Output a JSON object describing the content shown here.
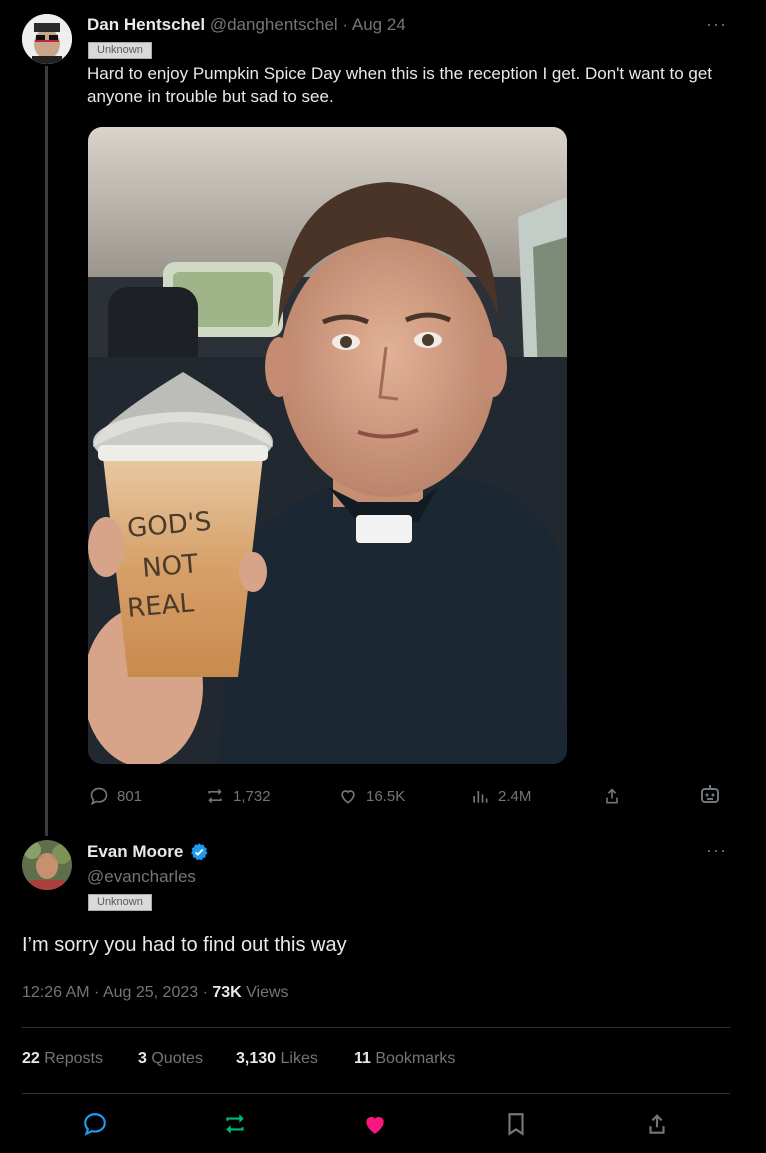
{
  "tweet1": {
    "author_name": "Dan Hentschel",
    "handle": "@danghentschel",
    "date": "· Aug 24",
    "badge": "Unknown",
    "text": "Hard to enjoy Pumpkin Spice Day when this is the reception I get. Don't want to get anyone in trouble but sad to see.",
    "cup_writing": [
      "GOD'S",
      "NOT",
      "REAL"
    ],
    "actions": {
      "replies": "801",
      "reposts": "1,732",
      "likes": "16.5K",
      "views": "2.4M"
    },
    "more_icon": "···"
  },
  "tweet2": {
    "author_name": "Evan Moore",
    "handle": "@evancharles",
    "badge": "Unknown",
    "text": "I’m sorry you had to find out this way",
    "timestamp": "12:26 AM · Aug 25, 2023 · ",
    "views_count": "73K",
    "views_label": " Views",
    "stats": {
      "reposts_count": "22",
      "reposts_label": " Reposts",
      "quotes_count": "3",
      "quotes_label": " Quotes",
      "likes_count": "3,130",
      "likes_label": " Likes",
      "bookmarks_count": "11",
      "bookmarks_label": " Bookmarks"
    },
    "more_icon": "···"
  },
  "colors": {
    "background": "#000000",
    "text": "#e7e9ea",
    "muted": "#71767b",
    "verified": "#1d9bf0",
    "liked": "#f91880",
    "repost_green": "#00ba7c"
  }
}
